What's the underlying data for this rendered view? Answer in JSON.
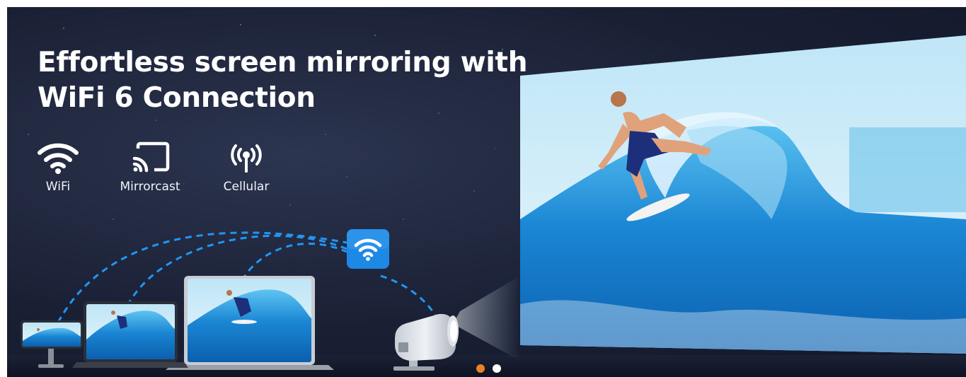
{
  "banner": {
    "headline_line1": "Effortless screen mirroring with",
    "headline_line2": "WiFi 6 Connection"
  },
  "features": [
    {
      "icon": "wifi-icon",
      "label": "WiFi"
    },
    {
      "icon": "screen-cast-icon",
      "label": "Mirrorcast"
    },
    {
      "icon": "cellular-signal-icon",
      "label": "Cellular"
    }
  ],
  "illustration": {
    "devices": [
      "smartphone-on-stand",
      "tablet",
      "laptop",
      "projector"
    ],
    "connection_badge_icon": "wifi-icon",
    "projected_image": "surfer-on-wave"
  },
  "carousel": {
    "slide_count": 2,
    "active_index": 0,
    "active_color": "#e8822a",
    "inactive_color": "#ffffff"
  },
  "colors": {
    "background": "#1a2034",
    "accent_blue": "#1e88e5",
    "dashed_line": "#2196f3"
  }
}
